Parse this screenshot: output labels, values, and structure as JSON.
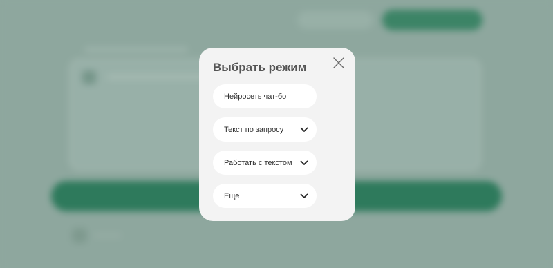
{
  "modal": {
    "title": "Выбрать режим",
    "close_icon": "close-icon",
    "items": [
      {
        "label": "Нейросеть чат-бот",
        "expandable": false
      },
      {
        "label": "Текст по запросу",
        "expandable": true
      },
      {
        "label": "Работать с текстом",
        "expandable": true
      },
      {
        "label": "Еще",
        "expandable": true
      }
    ]
  },
  "colors": {
    "overlay": "#8fa89f",
    "modal_bg": "#f3f3f3",
    "item_bg": "#ffffff",
    "title": "#555555",
    "accent_green": "#2e7a5c"
  }
}
